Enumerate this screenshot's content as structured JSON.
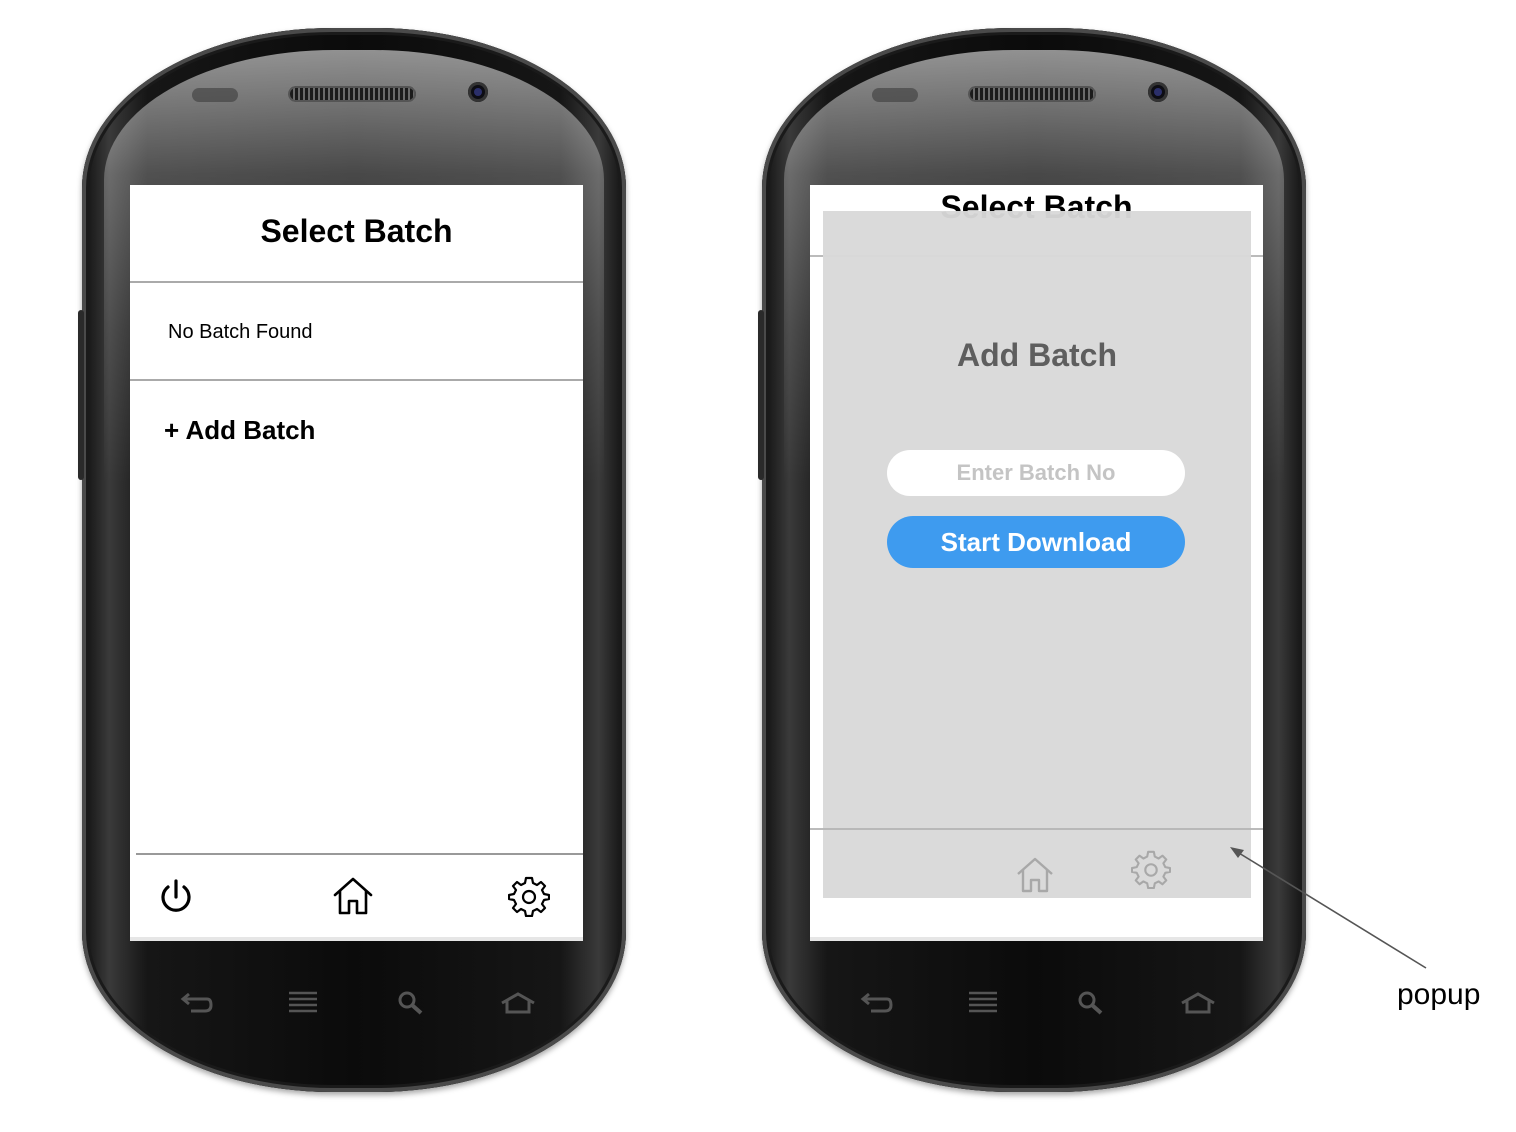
{
  "left_screen": {
    "title": "Select Batch",
    "empty_message": "No Batch Found",
    "add_batch_label": "+ Add Batch",
    "nav": {
      "power_icon": "power-icon",
      "home_icon": "home-icon",
      "settings_icon": "gear-icon"
    }
  },
  "right_screen": {
    "title": "Select Batch",
    "popup": {
      "title": "Add Batch",
      "input_placeholder": "Enter Batch No",
      "button_label": "Start Download"
    },
    "nav": {
      "home_icon": "home-icon",
      "settings_icon": "gear-icon"
    }
  },
  "annotation": {
    "label": "popup"
  },
  "colors": {
    "accent": "#3e9bef",
    "popup_bg": "#d8d8d8",
    "divider": "#aaaaaa",
    "muted_text": "#5e5e5e"
  },
  "hardware_keys": [
    "back-icon",
    "menu-icon",
    "search-icon",
    "home-icon"
  ]
}
